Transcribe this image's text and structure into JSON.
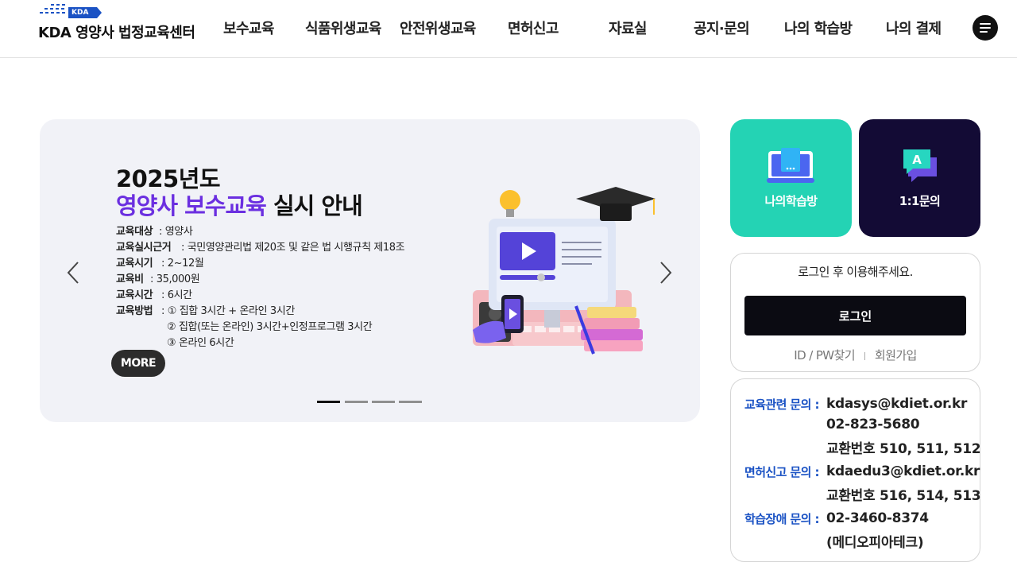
{
  "header": {
    "logo_badge": "KDA",
    "logo_text": "KDA 영양사 법정교육센터",
    "nav": [
      "보수교육",
      "식품위생교육",
      "안전위생교육",
      "면허신고",
      "자료실",
      "공지·문의",
      "나의 학습방",
      "나의 결제"
    ],
    "menu_icon": "hamburger-menu-icon"
  },
  "slider": {
    "year_title": "2025년도",
    "title_highlight": "영양사 보수교육",
    "title_rest": " 실시 안내",
    "info": [
      {
        "label": "교육대상",
        "value": ": 영양사"
      },
      {
        "label": "교육실시근거",
        "value": ": 국민영양관리법 제20조 및 같은 법 시행규칙 제18조"
      },
      {
        "label": "교육시기",
        "value": ": 2~12월"
      },
      {
        "label": "교육비",
        "value": ": 35,000원"
      },
      {
        "label": "교육시간",
        "value": ": 6시간"
      },
      {
        "label": "교육방법",
        "value": ": ① 집합 3시간 + 온라인 3시간"
      }
    ],
    "method_lines": [
      "② 집합(또는 온라인) 3시간+인정프로그램 3시간",
      "③ 온라인 6시간"
    ],
    "more_label": "MORE",
    "prev_icon": "chevron-left-icon",
    "next_icon": "chevron-right-icon",
    "slide_count": 4,
    "active_slide": 1
  },
  "tiles": [
    {
      "label": "나의학습방",
      "icon": "laptop-book-icon",
      "color": "#24d3b4"
    },
    {
      "label": "1:1문의",
      "icon": "chat-bubble-icon",
      "color": "#130b35"
    }
  ],
  "login": {
    "message": "로그인 후 이용해주세요.",
    "button": "로그인",
    "find_link": "ID / PW찾기",
    "join_link": "회원가입"
  },
  "contacts": [
    {
      "label": "교육관련 문의 :",
      "lines": [
        "kdasys@kdiet.or.kr",
        "02-823-5680",
        "교환번호 510, 511, 512"
      ]
    },
    {
      "label": "면허신고 문의 :",
      "lines": [
        "kdaedu3@kdiet.or.kr",
        "교환번호 516, 514, 513"
      ]
    },
    {
      "label": "학습장애 문의 :",
      "lines": [
        "02-3460-8374",
        "(메디오피아테크)"
      ]
    }
  ],
  "colors": {
    "accent_purple": "#6b2fe0",
    "teal": "#24d3b4",
    "navy": "#130b35",
    "contact_blue": "#1a52c4"
  }
}
